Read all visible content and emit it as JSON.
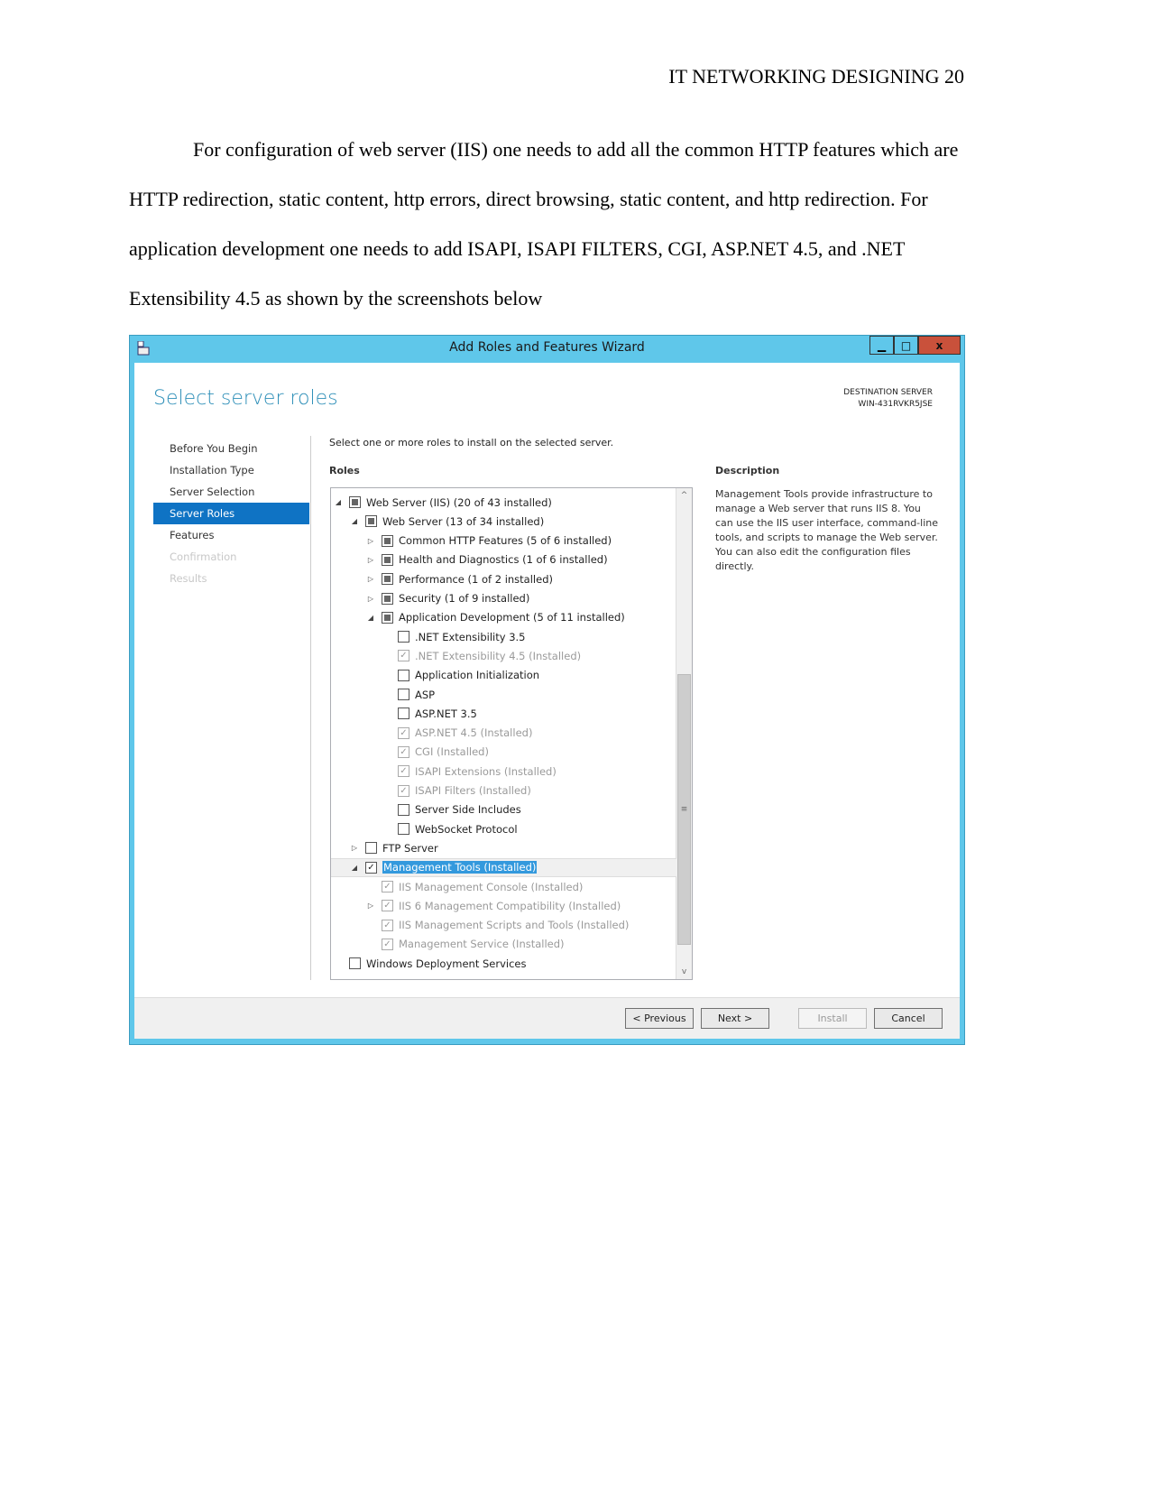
{
  "document": {
    "header": "IT NETWORKING DESIGNING 20",
    "paragraph": "For configuration of web server (IIS) one needs to add all the common HTTP features which are HTTP redirection, static content, http errors, direct browsing, static content, and http redirection. For application development one needs to add ISAPI, ISAPI FILTERS, CGI, ASP.NET 4.5, and .NET Extensibility 4.5 as shown by the screenshots below"
  },
  "window": {
    "title": "Add Roles and Features Wizard",
    "accent": "#5fc7ea",
    "controls": {
      "minimize": "▁",
      "maximize": "□",
      "close": "x"
    },
    "page_title": "Select server roles",
    "destination_label": "DESTINATION SERVER",
    "destination_server": "WIN-431RVKR5JSE",
    "nav": [
      {
        "label": "Before You Begin",
        "state": "normal"
      },
      {
        "label": "Installation Type",
        "state": "normal"
      },
      {
        "label": "Server Selection",
        "state": "normal"
      },
      {
        "label": "Server Roles",
        "state": "selected"
      },
      {
        "label": "Features",
        "state": "normal"
      },
      {
        "label": "Confirmation",
        "state": "disabled"
      },
      {
        "label": "Results",
        "state": "disabled"
      }
    ],
    "instruction": "Select one or more roles to install on the selected server.",
    "roles_label": "Roles",
    "roles": [
      {
        "level": 0,
        "toggle": "expanded",
        "check": "partial",
        "label": "Web Server (IIS) (20 of 43 installed)"
      },
      {
        "level": 1,
        "toggle": "expanded",
        "check": "partial",
        "label": "Web Server (13 of 34 installed)"
      },
      {
        "level": 2,
        "toggle": "collapsed",
        "check": "partial",
        "label": "Common HTTP Features (5 of 6 installed)"
      },
      {
        "level": 2,
        "toggle": "collapsed",
        "check": "partial",
        "label": "Health and Diagnostics (1 of 6 installed)"
      },
      {
        "level": 2,
        "toggle": "collapsed",
        "check": "partial",
        "label": "Performance (1 of 2 installed)"
      },
      {
        "level": 2,
        "toggle": "collapsed",
        "check": "partial",
        "label": "Security (1 of 9 installed)"
      },
      {
        "level": 2,
        "toggle": "expanded",
        "check": "partial",
        "label": "Application Development (5 of 11 installed)"
      },
      {
        "level": 3,
        "toggle": "none",
        "check": "unchecked",
        "label": ".NET Extensibility 3.5"
      },
      {
        "level": 3,
        "toggle": "none",
        "check": "installed",
        "label": ".NET Extensibility 4.5 (Installed)"
      },
      {
        "level": 3,
        "toggle": "none",
        "check": "unchecked",
        "label": "Application Initialization"
      },
      {
        "level": 3,
        "toggle": "none",
        "check": "unchecked",
        "label": "ASP"
      },
      {
        "level": 3,
        "toggle": "none",
        "check": "unchecked",
        "label": "ASP.NET 3.5"
      },
      {
        "level": 3,
        "toggle": "none",
        "check": "installed",
        "label": "ASP.NET 4.5 (Installed)"
      },
      {
        "level": 3,
        "toggle": "none",
        "check": "installed",
        "label": "CGI (Installed)"
      },
      {
        "level": 3,
        "toggle": "none",
        "check": "installed",
        "label": "ISAPI Extensions (Installed)"
      },
      {
        "level": 3,
        "toggle": "none",
        "check": "installed",
        "label": "ISAPI Filters (Installed)"
      },
      {
        "level": 3,
        "toggle": "none",
        "check": "unchecked",
        "label": "Server Side Includes"
      },
      {
        "level": 3,
        "toggle": "none",
        "check": "unchecked",
        "label": "WebSocket Protocol"
      },
      {
        "level": 1,
        "toggle": "collapsed",
        "check": "unchecked",
        "label": "FTP Server"
      },
      {
        "level": 1,
        "toggle": "expanded",
        "check": "checked",
        "label": "Management Tools (Installed)",
        "selected": true
      },
      {
        "level": 2,
        "toggle": "none",
        "check": "installed",
        "label": "IIS Management Console (Installed)"
      },
      {
        "level": 2,
        "toggle": "collapsed",
        "check": "installed",
        "label": "IIS 6 Management Compatibility (Installed)"
      },
      {
        "level": 2,
        "toggle": "none",
        "check": "installed",
        "label": "IIS Management Scripts and Tools (Installed)"
      },
      {
        "level": 2,
        "toggle": "none",
        "check": "installed",
        "label": "Management Service (Installed)"
      },
      {
        "level": 0,
        "toggle": "none",
        "check": "unchecked",
        "label": "Windows Deployment Services"
      }
    ],
    "description_label": "Description",
    "description": "Management Tools provide infrastructure to manage a Web server that runs IIS 8. You can use the IIS user interface, command-line tools, and scripts to manage the Web server. You can also edit the configuration files directly.",
    "buttons": {
      "previous": "< Previous",
      "next": "Next >",
      "install": "Install",
      "cancel": "Cancel"
    }
  }
}
